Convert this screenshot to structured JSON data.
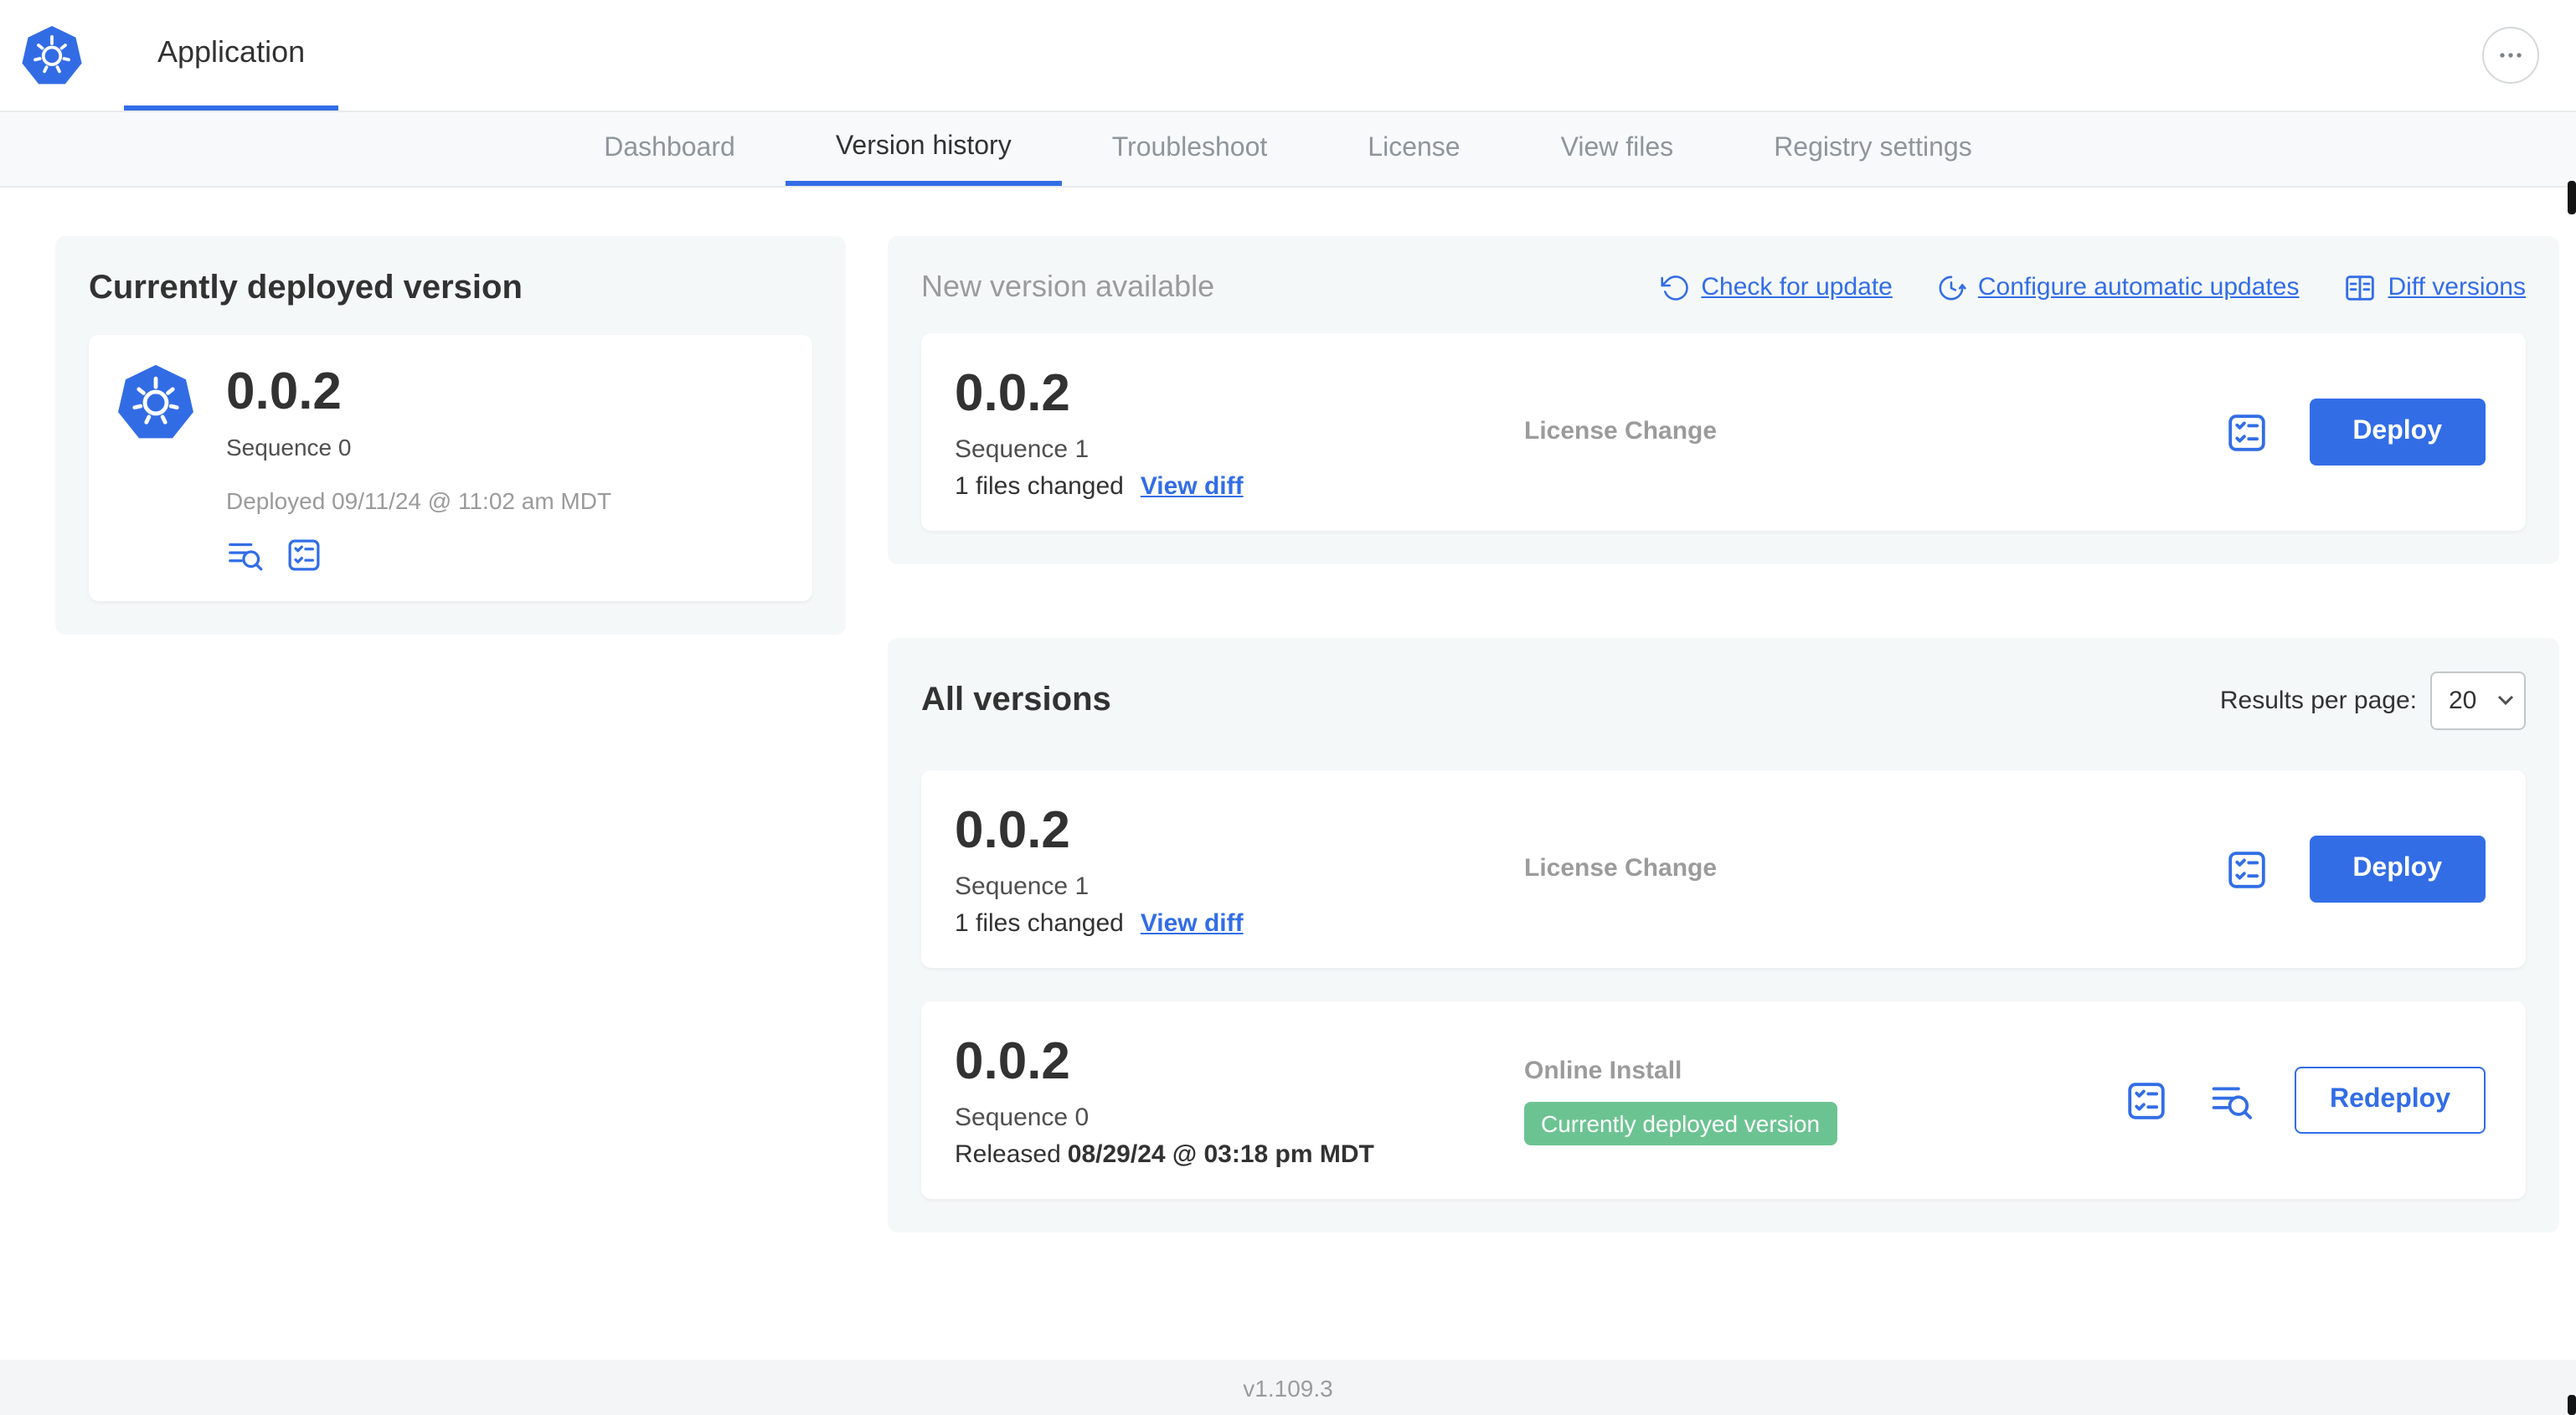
{
  "header": {
    "app_tab": "Application",
    "logo_icon": "kubernetes-icon",
    "menu_icon": "ellipsis-icon"
  },
  "nav": {
    "tabs": [
      {
        "label": "Dashboard",
        "active": false
      },
      {
        "label": "Version history",
        "active": true
      },
      {
        "label": "Troubleshoot",
        "active": false
      },
      {
        "label": "License",
        "active": false
      },
      {
        "label": "View files",
        "active": false
      },
      {
        "label": "Registry settings",
        "active": false
      }
    ]
  },
  "current_version": {
    "title": "Currently deployed version",
    "version": "0.0.2",
    "sequence": "Sequence 0",
    "deployed": "Deployed 09/11/24 @ 11:02 am MDT",
    "icons": [
      "logs-icon",
      "release-notes-icon"
    ]
  },
  "new_version": {
    "title": "New version available",
    "actions": [
      {
        "label": "Check for update",
        "icon": "refresh-icon"
      },
      {
        "label": "Configure automatic updates",
        "icon": "auto-update-icon"
      },
      {
        "label": "Diff versions",
        "icon": "diff-icon"
      }
    ],
    "row": {
      "version": "0.0.2",
      "sequence": "Sequence 1",
      "files_changed": "1 files changed",
      "view_diff_label": "View diff",
      "source": "License Change",
      "deploy_label": "Deploy"
    }
  },
  "all_versions": {
    "title": "All versions",
    "results_per_page_label": "Results per page:",
    "results_per_page_value": "20",
    "rows": [
      {
        "version": "0.0.2",
        "sequence": "Sequence 1",
        "files_changed": "1 files changed",
        "view_diff_label": "View diff",
        "source": "License Change",
        "action_label": "Deploy"
      },
      {
        "version": "0.0.2",
        "sequence": "Sequence 0",
        "released_prefix": "Released",
        "released_date": "08/29/24 @ 03:18 pm MDT",
        "source": "Online Install",
        "badge": "Currently deployed version",
        "action_label": "Redeploy"
      }
    ]
  },
  "footer": {
    "version_label": "v1.109.3"
  },
  "colors": {
    "accent_blue": "#326de6",
    "kubernetes_blue": "#326ce5",
    "badge_green": "#6cc392",
    "card_bg": "#f5f8f9",
    "muted_text": "#9b9b9b",
    "dark_text": "#323232"
  }
}
